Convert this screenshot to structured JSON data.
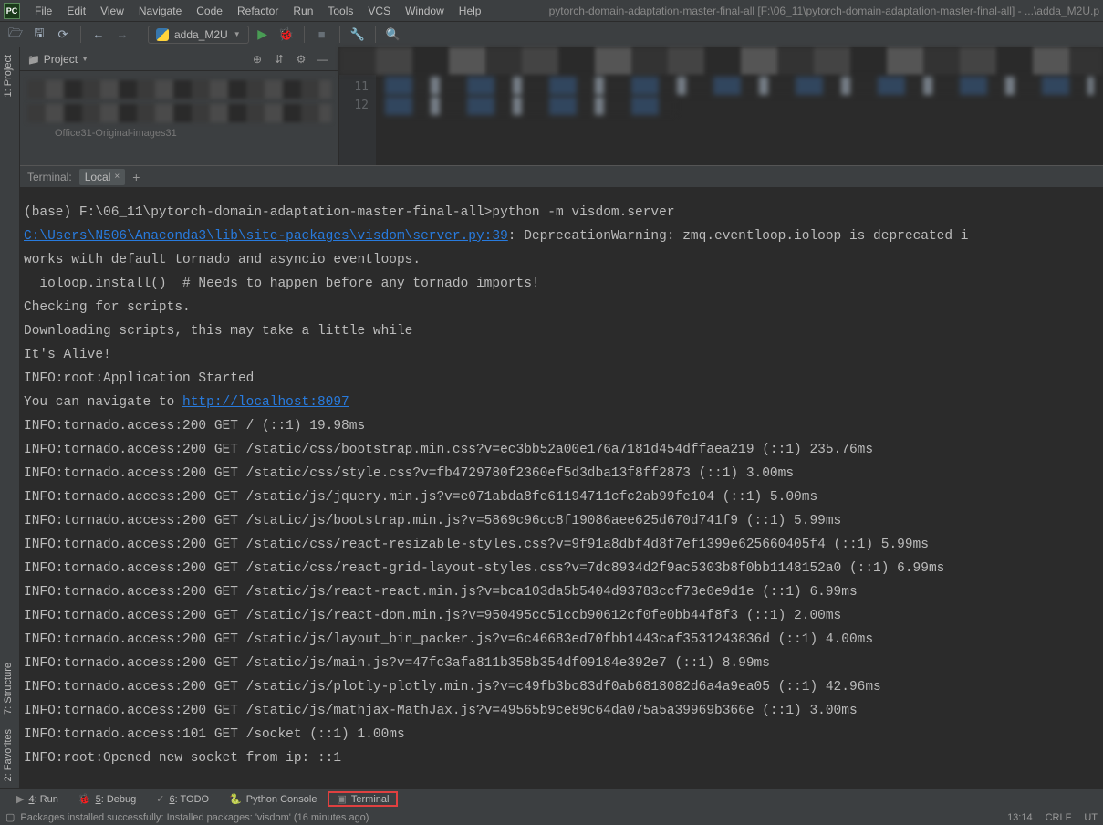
{
  "menu": {
    "items": [
      "File",
      "Edit",
      "View",
      "Navigate",
      "Code",
      "Refactor",
      "Run",
      "Tools",
      "VCS",
      "Window",
      "Help"
    ],
    "underline_idx": [
      0,
      0,
      0,
      0,
      0,
      1,
      1,
      0,
      2,
      0,
      0
    ]
  },
  "title": "pytorch-domain-adaptation-master-final-all [F:\\06_11\\pytorch-domain-adaptation-master-final-all] - ...\\adda_M2U.p",
  "run_config": "adda_M2U",
  "project": {
    "label": "Project",
    "tree_hint": "Office31-Original-images31"
  },
  "editor": {
    "line_numbers": [
      "11",
      "12"
    ]
  },
  "left_tabs": [
    "1: Project",
    "7: Structure",
    "2: Favorites"
  ],
  "terminal": {
    "label": "Terminal:",
    "tab": "Local",
    "lines": [
      {
        "t": "plain",
        "v": ""
      },
      {
        "t": "plain",
        "v": "(base) F:\\06_11\\pytorch-domain-adaptation-master-final-all>python -m visdom.server"
      },
      {
        "t": "mix",
        "pre": "",
        "link": "C:\\Users\\N506\\Anaconda3\\lib\\site-packages\\visdom\\server.py:39",
        "post": ": DeprecationWarning: zmq.eventloop.ioloop is deprecated i"
      },
      {
        "t": "plain",
        "v": "works with default tornado and asyncio eventloops."
      },
      {
        "t": "plain",
        "v": "  ioloop.install()  # Needs to happen before any tornado imports!"
      },
      {
        "t": "plain",
        "v": "Checking for scripts."
      },
      {
        "t": "plain",
        "v": "Downloading scripts, this may take a little while"
      },
      {
        "t": "plain",
        "v": "It's Alive!"
      },
      {
        "t": "plain",
        "v": "INFO:root:Application Started"
      },
      {
        "t": "mix",
        "pre": "You can navigate to ",
        "link": "http://localhost:8097",
        "post": ""
      },
      {
        "t": "plain",
        "v": "INFO:tornado.access:200 GET / (::1) 19.98ms"
      },
      {
        "t": "plain",
        "v": "INFO:tornado.access:200 GET /static/css/bootstrap.min.css?v=ec3bb52a00e176a7181d454dffaea219 (::1) 235.76ms"
      },
      {
        "t": "plain",
        "v": "INFO:tornado.access:200 GET /static/css/style.css?v=fb4729780f2360ef5d3dba13f8ff2873 (::1) 3.00ms"
      },
      {
        "t": "plain",
        "v": "INFO:tornado.access:200 GET /static/js/jquery.min.js?v=e071abda8fe61194711cfc2ab99fe104 (::1) 5.00ms"
      },
      {
        "t": "plain",
        "v": "INFO:tornado.access:200 GET /static/js/bootstrap.min.js?v=5869c96cc8f19086aee625d670d741f9 (::1) 5.99ms"
      },
      {
        "t": "plain",
        "v": "INFO:tornado.access:200 GET /static/css/react-resizable-styles.css?v=9f91a8dbf4d8f7ef1399e625660405f4 (::1) 5.99ms"
      },
      {
        "t": "plain",
        "v": "INFO:tornado.access:200 GET /static/css/react-grid-layout-styles.css?v=7dc8934d2f9ac5303b8f0bb1148152a0 (::1) 6.99ms"
      },
      {
        "t": "plain",
        "v": "INFO:tornado.access:200 GET /static/js/react-react.min.js?v=bca103da5b5404d93783ccf73e0e9d1e (::1) 6.99ms"
      },
      {
        "t": "plain",
        "v": "INFO:tornado.access:200 GET /static/js/react-dom.min.js?v=950495cc51ccb90612cf0fe0bb44f8f3 (::1) 2.00ms"
      },
      {
        "t": "plain",
        "v": "INFO:tornado.access:200 GET /static/js/layout_bin_packer.js?v=6c46683ed70fbb1443caf3531243836d (::1) 4.00ms"
      },
      {
        "t": "plain",
        "v": "INFO:tornado.access:200 GET /static/js/main.js?v=47fc3afa811b358b354df09184e392e7 (::1) 8.99ms"
      },
      {
        "t": "plain",
        "v": "INFO:tornado.access:200 GET /static/js/plotly-plotly.min.js?v=c49fb3bc83df0ab6818082d6a4a9ea05 (::1) 42.96ms"
      },
      {
        "t": "plain",
        "v": "INFO:tornado.access:200 GET /static/js/mathjax-MathJax.js?v=49565b9ce89c64da075a5a39969b366e (::1) 3.00ms"
      },
      {
        "t": "plain",
        "v": "INFO:tornado.access:101 GET /socket (::1) 1.00ms"
      },
      {
        "t": "plain",
        "v": "INFO:root:Opened new socket from ip: ::1"
      }
    ]
  },
  "bottom_tabs": {
    "run": "4: Run",
    "debug": "5: Debug",
    "todo": "6: TODO",
    "console": "Python Console",
    "terminal": "Terminal"
  },
  "status": {
    "msg": "Packages installed successfully: Installed packages: 'visdom' (16 minutes ago)",
    "time": "13:14",
    "eol": "CRLF",
    "enc": "UT"
  }
}
